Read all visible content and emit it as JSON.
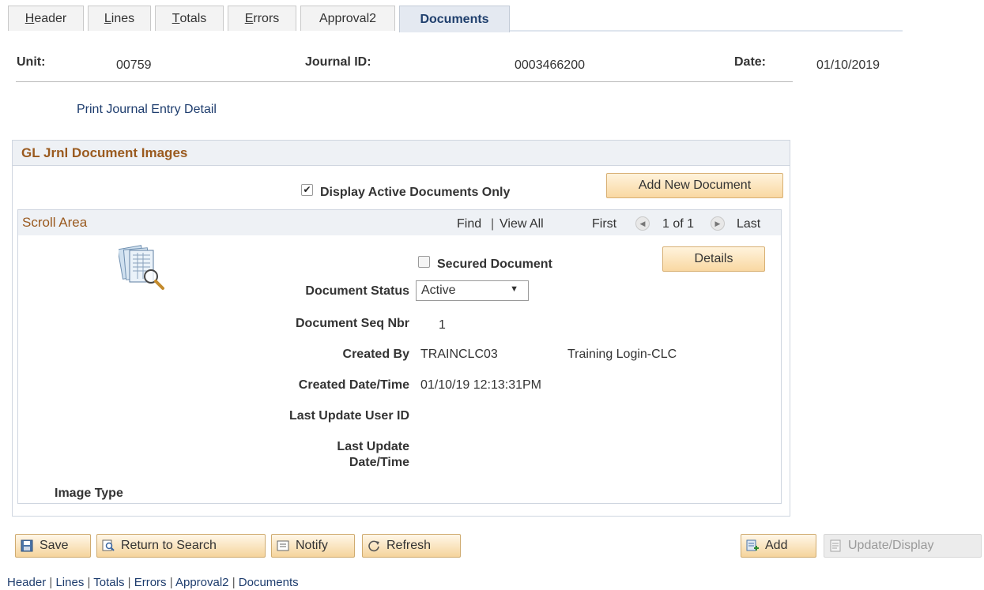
{
  "tabs": [
    {
      "label": "Header",
      "underline": "H",
      "rest": "eader"
    },
    {
      "label": "Lines",
      "underline": "L",
      "rest": "ines"
    },
    {
      "label": "Totals",
      "underline": "T",
      "rest": "otals"
    },
    {
      "label": "Errors",
      "underline": "E",
      "rest": "rrors"
    },
    {
      "label": "Approval2"
    },
    {
      "label": "Documents",
      "active": true
    }
  ],
  "header": {
    "unit_label": "Unit:",
    "unit_value": "00759",
    "journal_label": "Journal ID:",
    "journal_value": "0003466200",
    "date_label": "Date:",
    "date_value": "01/10/2019"
  },
  "print_link": "Print Journal Entry Detail",
  "gl_box": {
    "title": "GL Jrnl Document Images",
    "display_active_label": "Display Active Documents Only",
    "display_active_checked": true,
    "add_new_button": "Add New Document"
  },
  "scroll_area": {
    "title": "Scroll Area",
    "find": "Find",
    "view_all": "View All",
    "sep": "|",
    "first": "First",
    "page_info": "1 of 1",
    "last": "Last",
    "secured_label": "Secured Document",
    "secured_checked": false,
    "details_button": "Details",
    "fields": {
      "document_status_label": "Document Status",
      "document_status_value": "Active",
      "document_seq_label": "Document Seq Nbr",
      "document_seq_value": "1",
      "created_by_label": "Created By",
      "created_by_id": "TRAINCLC03",
      "created_by_name": "Training Login-CLC",
      "created_dt_label": "Created Date/Time",
      "created_dt_value": "01/10/19 12:13:31PM",
      "last_update_user_label": "Last Update User ID",
      "last_update_dt_label_1": "Last Update",
      "last_update_dt_label_2": "Date/Time",
      "image_type_label": "Image Type"
    }
  },
  "toolbar": {
    "save": "Save",
    "return_to_search": "Return to Search",
    "notify": "Notify",
    "refresh": "Refresh",
    "add": "Add",
    "update_display": "Update/Display"
  },
  "bottom_links": [
    "Header",
    "Lines",
    "Totals",
    "Errors",
    "Approval2",
    "Documents"
  ],
  "colors": {
    "section_title": "#9a5a1f",
    "link": "#1e3d6e",
    "button_gradient_end": "#f5d49c"
  }
}
